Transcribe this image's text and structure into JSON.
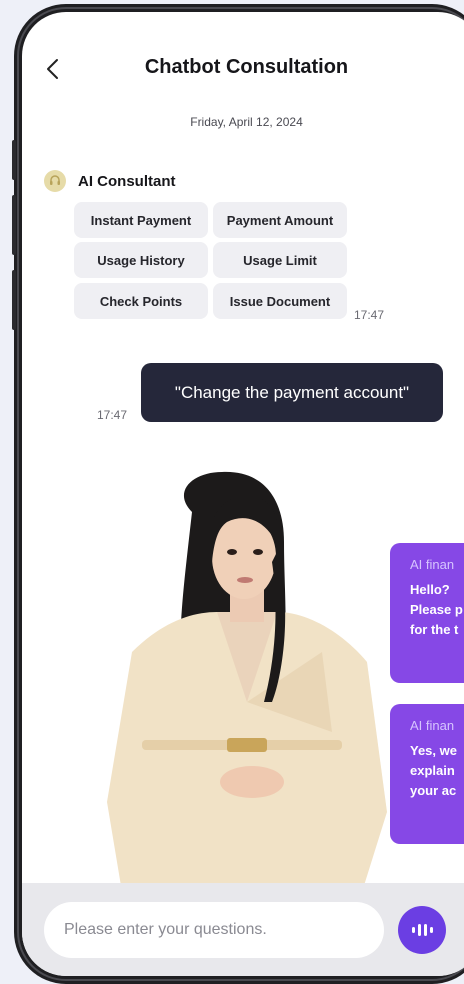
{
  "header": {
    "title": "Chatbot Consultation",
    "back_icon": "chevron-left-icon"
  },
  "chat": {
    "date": "Friday, April 12, 2024",
    "agent_name": "AI Consultant",
    "quick_replies": [
      "Instant Payment",
      "Payment Amount",
      "Usage History",
      "Usage Limit",
      "Check Points",
      "Issue Document"
    ],
    "bot_time": "17:47",
    "user_message": "\"Change the payment account\"",
    "user_time": "17:47"
  },
  "ai_cards": [
    {
      "label": "AI finan",
      "lines": [
        "Hello?",
        "Please p",
        "for the t"
      ]
    },
    {
      "label": "AI finan",
      "lines": [
        "Yes, we",
        "explain",
        "your ac"
      ]
    }
  ],
  "composer": {
    "placeholder": "Please enter your questions.",
    "mic_icon": "voice-wave-icon"
  },
  "colors": {
    "accent": "#8648e6",
    "user_bubble": "#25273a",
    "chip": "#efeff3"
  }
}
